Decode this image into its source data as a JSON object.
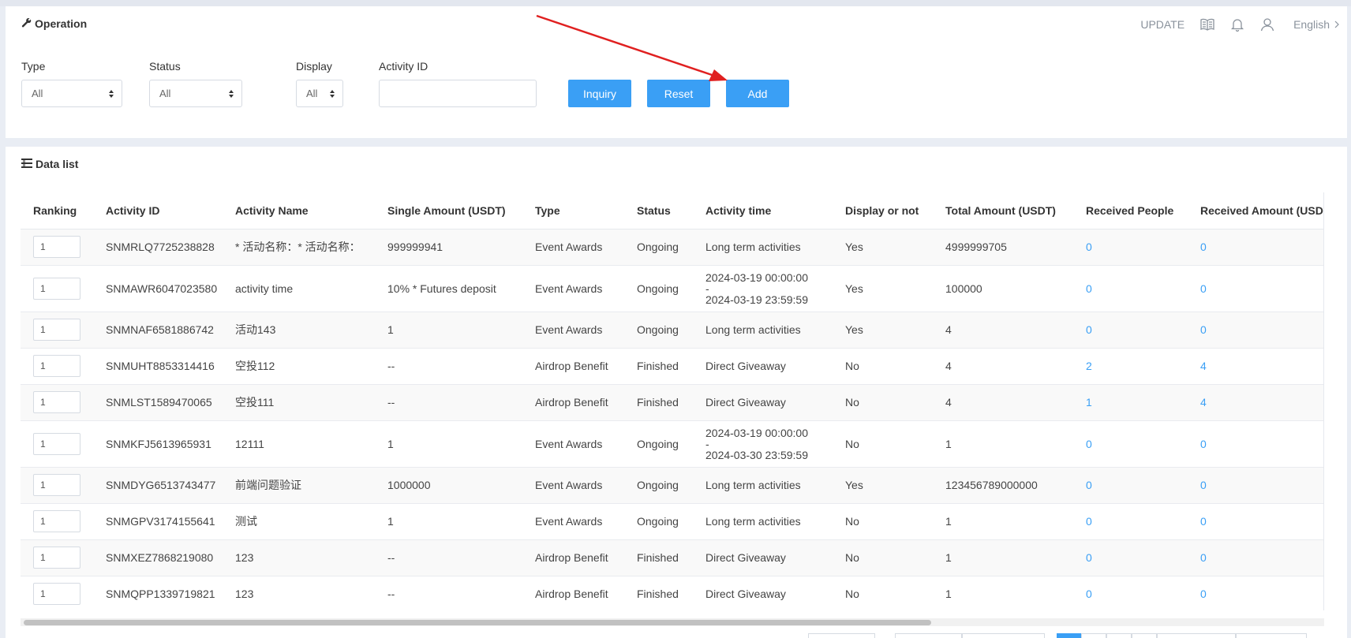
{
  "operation": {
    "title": "Operation",
    "top_right": {
      "update_label": "UPDATE",
      "icons": [
        "book-icon",
        "bell-icon",
        "user-icon"
      ],
      "language": "English"
    },
    "filters": {
      "type": {
        "label": "Type",
        "value": "All"
      },
      "status": {
        "label": "Status",
        "value": "All"
      },
      "display": {
        "label": "Display",
        "value": "All"
      },
      "activity_id": {
        "label": "Activity ID",
        "value": ""
      }
    },
    "buttons": {
      "inquiry": "Inquiry",
      "reset": "Reset",
      "add": "Add"
    }
  },
  "data_list": {
    "title": "Data list",
    "columns": [
      "Ranking",
      "Activity ID",
      "Activity Name",
      "Single Amount (USDT)",
      "Type",
      "Status",
      "Activity time",
      "Display or not",
      "Total Amount (USDT)",
      "Received People",
      "Received Amount (USDT)"
    ],
    "rows": [
      {
        "rank": "1",
        "id": "SNMRLQ7725238828",
        "name": "* 活动名称：* 活动名称：",
        "single": "999999941",
        "type": "Event Awards",
        "status": "Ongoing",
        "time1": "Long term activities",
        "time2": "",
        "time3": "",
        "display": "Yes",
        "total": "4999999705",
        "people": "0",
        "amount": "0"
      },
      {
        "rank": "1",
        "id": "SNMAWR6047023580",
        "name": "activity time",
        "single": "10% * Futures deposit",
        "type": "Event Awards",
        "status": "Ongoing",
        "time1": "2024-03-19 00:00:00",
        "time2": "-",
        "time3": "2024-03-19 23:59:59",
        "display": "Yes",
        "total": "100000",
        "people": "0",
        "amount": "0"
      },
      {
        "rank": "1",
        "id": "SNMNAF6581886742",
        "name": "活动143",
        "single": "1",
        "type": "Event Awards",
        "status": "Ongoing",
        "time1": "Long term activities",
        "time2": "",
        "time3": "",
        "display": "Yes",
        "total": "4",
        "people": "0",
        "amount": "0"
      },
      {
        "rank": "1",
        "id": "SNMUHT8853314416",
        "name": "空投112",
        "single": "--",
        "type": "Airdrop Benefit",
        "status": "Finished",
        "time1": "Direct Giveaway",
        "time2": "",
        "time3": "",
        "display": "No",
        "total": "4",
        "people": "2",
        "amount": "4"
      },
      {
        "rank": "1",
        "id": "SNMLST1589470065",
        "name": "空投111",
        "single": "--",
        "type": "Airdrop Benefit",
        "status": "Finished",
        "time1": "Direct Giveaway",
        "time2": "",
        "time3": "",
        "display": "No",
        "total": "4",
        "people": "1",
        "amount": "4"
      },
      {
        "rank": "1",
        "id": "SNMKFJ5613965931",
        "name": "12111",
        "single": "1",
        "type": "Event Awards",
        "status": "Ongoing",
        "time1": "2024-03-19 00:00:00",
        "time2": "-",
        "time3": "2024-03-30 23:59:59",
        "display": "No",
        "total": "1",
        "people": "0",
        "amount": "0"
      },
      {
        "rank": "1",
        "id": "SNMDYG6513743477",
        "name": "前端问题验证",
        "single": "1000000",
        "type": "Event Awards",
        "status": "Ongoing",
        "time1": "Long term activities",
        "time2": "",
        "time3": "",
        "display": "Yes",
        "total": "123456789000000",
        "people": "0",
        "amount": "0"
      },
      {
        "rank": "1",
        "id": "SNMGPV3174155641",
        "name": "测试",
        "single": "1",
        "type": "Event Awards",
        "status": "Ongoing",
        "time1": "Long term activities",
        "time2": "",
        "time3": "",
        "display": "No",
        "total": "1",
        "people": "0",
        "amount": "0"
      },
      {
        "rank": "1",
        "id": "SNMXEZ7868219080",
        "name": "123",
        "single": "--",
        "type": "Airdrop Benefit",
        "status": "Finished",
        "time1": "Direct Giveaway",
        "time2": "",
        "time3": "",
        "display": "No",
        "total": "1",
        "people": "0",
        "amount": "0"
      },
      {
        "rank": "1",
        "id": "SNMQPP1339719821",
        "name": "123",
        "single": "--",
        "type": "Airdrop Benefit",
        "status": "Finished",
        "time1": "Direct Giveaway",
        "time2": "",
        "time3": "",
        "display": "No",
        "total": "1",
        "people": "0",
        "amount": "0"
      }
    ]
  },
  "colors": {
    "accent": "#3a9ff5",
    "annotation_arrow": "#e02020"
  }
}
